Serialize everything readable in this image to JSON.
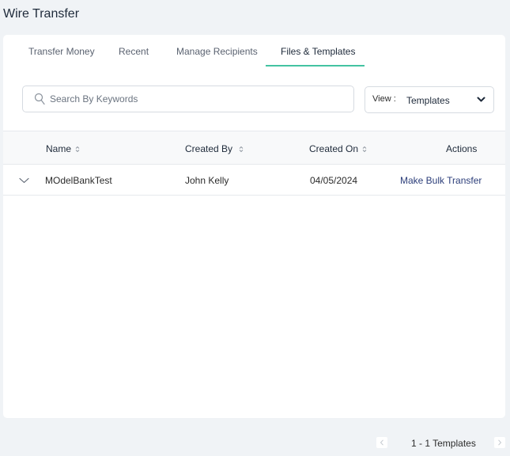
{
  "page": {
    "title": "Wire Transfer"
  },
  "tabs": [
    {
      "label": "Transfer Money",
      "active": false
    },
    {
      "label": "Recent",
      "active": false
    },
    {
      "label": "Manage Recipients",
      "active": false
    },
    {
      "label": "Files & Templates",
      "active": true
    }
  ],
  "search": {
    "placeholder": "Search By Keywords",
    "value": ""
  },
  "view": {
    "label": "View :",
    "selected": "Templates"
  },
  "table": {
    "columns": [
      "Name",
      "Created By",
      "Created On",
      "Actions"
    ],
    "rows": [
      {
        "name": "MOdelBankTest",
        "created_by": "John Kelly",
        "created_on": "04/05/2024",
        "action": "Make Bulk Transfer"
      }
    ]
  },
  "pagination": {
    "summary": "1 - 1 Templates"
  },
  "colors": {
    "accent": "#44c3a2",
    "link": "#2c3e7a",
    "background": "#f0f3f6"
  }
}
